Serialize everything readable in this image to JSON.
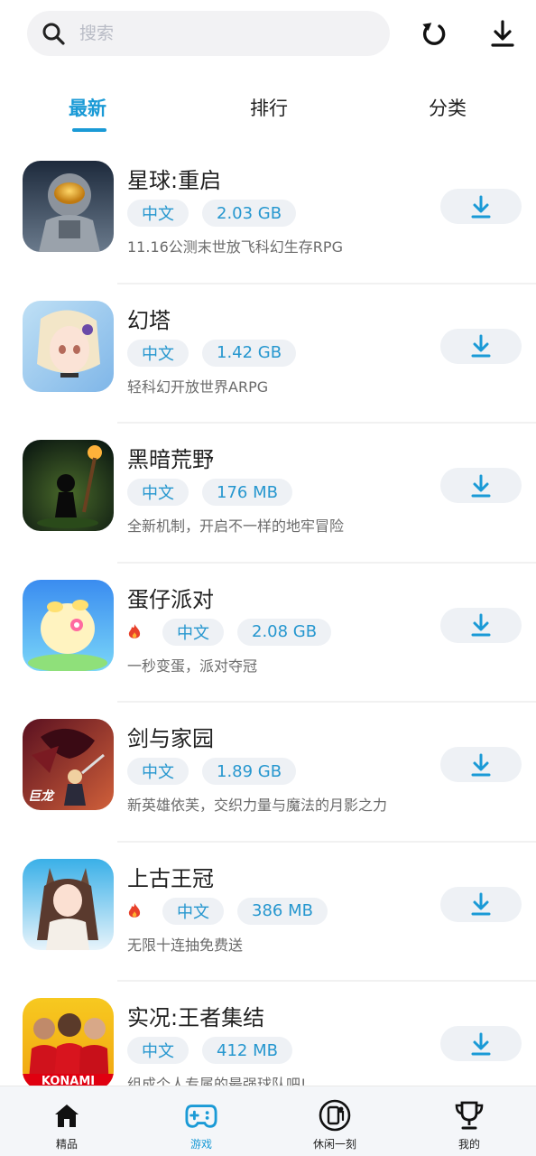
{
  "search": {
    "placeholder": "搜索"
  },
  "header": {
    "refresh_icon": "refresh-icon",
    "download_icon": "download-icon"
  },
  "tabs": [
    {
      "label": "最新",
      "active": true
    },
    {
      "label": "排行",
      "active": false
    },
    {
      "label": "分类",
      "active": false
    }
  ],
  "apps": [
    {
      "name": "星球:重启",
      "hot": false,
      "language": "中文",
      "size": "2.03 GB",
      "description": "11.16公测末世放飞科幻生存RPG"
    },
    {
      "name": "幻塔",
      "hot": false,
      "language": "中文",
      "size": "1.42 GB",
      "description": "轻科幻开放世界ARPG"
    },
    {
      "name": "黑暗荒野",
      "hot": false,
      "language": "中文",
      "size": "176 MB",
      "description": "全新机制，开启不一样的地牢冒险"
    },
    {
      "name": "蛋仔派对",
      "hot": true,
      "language": "中文",
      "size": "2.08 GB",
      "description": "一秒变蛋，派对夺冠"
    },
    {
      "name": "剑与家园",
      "hot": false,
      "language": "中文",
      "size": "1.89 GB",
      "description": "新英雄依芙，交织力量与魔法的月影之力",
      "icon_badge": "巨龙"
    },
    {
      "name": "上古王冠",
      "hot": true,
      "language": "中文",
      "size": "386 MB",
      "description": "无限十连抽免费送"
    },
    {
      "name": "实况:王者集结",
      "hot": false,
      "language": "中文",
      "size": "412 MB",
      "description": "组成个人专属的最强球队吧!",
      "icon_badge": "KONAMI"
    }
  ],
  "bottom_nav": [
    {
      "label": "精品",
      "icon": "home-icon",
      "active": false
    },
    {
      "label": "游戏",
      "icon": "gamepad-icon",
      "active": true
    },
    {
      "label": "休闲一刻",
      "icon": "phone-person-icon",
      "active": false
    },
    {
      "label": "我的",
      "icon": "trophy-icon",
      "active": false
    }
  ],
  "colors": {
    "accent": "#1a9ad6",
    "tag_bg": "#eef1f5",
    "hot": "#e8412b"
  }
}
